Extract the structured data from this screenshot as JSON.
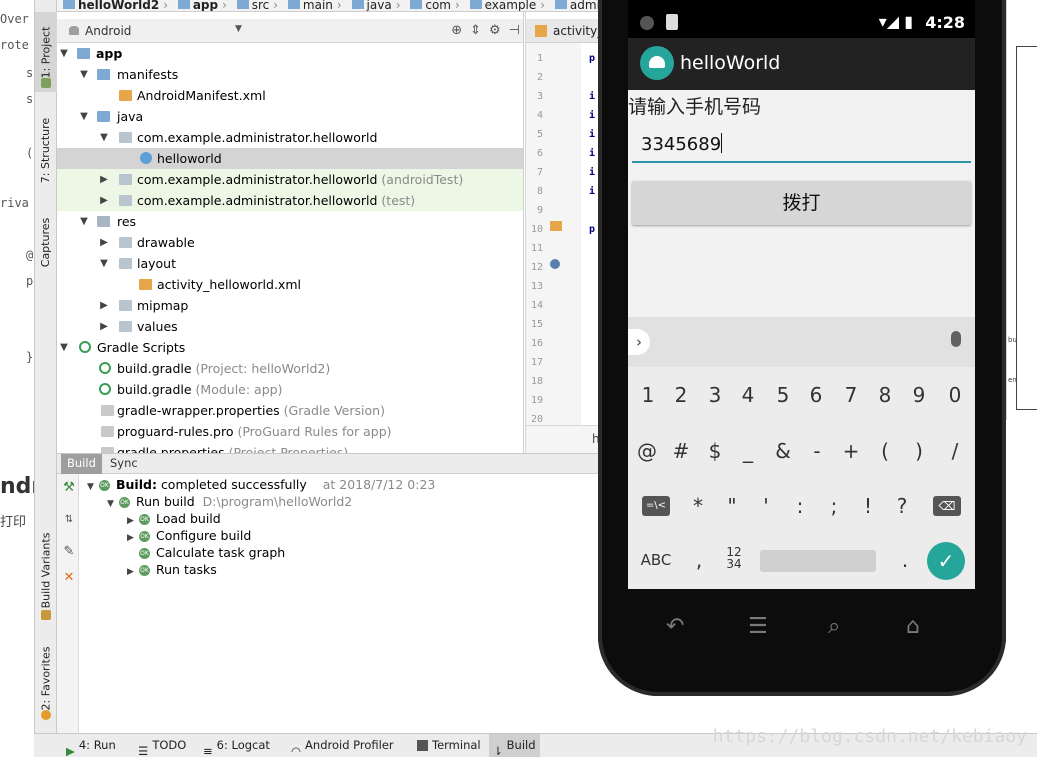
{
  "left_code": {
    "lines": [
      "Over",
      "rote",
      "s",
      "s",
      "(",
      "riva",
      "@",
      "p",
      "}"
    ],
    "big_text": "ndri",
    "cn_text": "打印"
  },
  "side_tabs": [
    "1: Project",
    "7: Structure",
    "Captures",
    "Build Variants",
    "2: Favorites"
  ],
  "navbar": {
    "crumbs": [
      "helloWorld2",
      "app",
      "src",
      "main",
      "java",
      "com",
      "example",
      "administrato"
    ]
  },
  "project": {
    "view_select": "Android",
    "tree": [
      {
        "label": "app",
        "hint": ""
      },
      {
        "label": "manifests",
        "hint": ""
      },
      {
        "label": "AndroidManifest.xml",
        "hint": ""
      },
      {
        "label": "java",
        "hint": ""
      },
      {
        "label": "com.example.administrator.helloworld",
        "hint": ""
      },
      {
        "label": "helloworld",
        "hint": ""
      },
      {
        "label": "com.example.administrator.helloworld",
        "hint": "(androidTest)"
      },
      {
        "label": "com.example.administrator.helloworld",
        "hint": "(test)"
      },
      {
        "label": "res",
        "hint": ""
      },
      {
        "label": "drawable",
        "hint": ""
      },
      {
        "label": "layout",
        "hint": ""
      },
      {
        "label": "activity_helloworld.xml",
        "hint": ""
      },
      {
        "label": "mipmap",
        "hint": ""
      },
      {
        "label": "values",
        "hint": ""
      },
      {
        "label": "Gradle Scripts",
        "hint": ""
      },
      {
        "label": "build.gradle",
        "hint": "(Project: helloWorld2)"
      },
      {
        "label": "build.gradle",
        "hint": "(Module: app)"
      },
      {
        "label": "gradle-wrapper.properties",
        "hint": "(Gradle Version)"
      },
      {
        "label": "proguard-rules.pro",
        "hint": "(ProGuard Rules for app)"
      },
      {
        "label": "gradle.properties",
        "hint": "(Project Properties)"
      }
    ]
  },
  "editor": {
    "tab_label": "activity_l",
    "line_numbers": [
      "1",
      "2",
      "3",
      "4",
      "5",
      "6",
      "7",
      "8",
      "9",
      "10",
      "11",
      "12",
      "13",
      "14",
      "15",
      "16",
      "17",
      "18",
      "19",
      "20"
    ],
    "code": [
      "p",
      "i",
      "i",
      "i",
      "i",
      "i",
      "i",
      "p"
    ],
    "status": "h"
  },
  "build": {
    "tabs": [
      "Build",
      "Sync"
    ],
    "summary_label": "Build:",
    "summary_text": "completed successfully",
    "summary_time": "at 2018/7/12 0:23",
    "run_build": "Run build",
    "run_path": "D:\\program\\helloWorld2",
    "steps": [
      "Load build",
      "Configure build",
      "Calculate task graph",
      "Run tasks"
    ]
  },
  "bottombar": {
    "items": [
      "4: Run",
      "TODO",
      "6: Logcat",
      "Android Profiler",
      "Terminal",
      "Build"
    ]
  },
  "phone": {
    "time": "4:28",
    "app_title": "helloWorld",
    "prompt": "请输入手机号码",
    "input_value": "3345689",
    "dial_button": "拨打",
    "keyboard": {
      "row1": [
        "1",
        "2",
        "3",
        "4",
        "5",
        "6",
        "7",
        "8",
        "9",
        "0"
      ],
      "row2": [
        "@",
        "#",
        "$",
        "_",
        "&",
        "-",
        "+",
        "(",
        ")",
        "/"
      ],
      "row3": [
        "=\\<",
        "*",
        "\"",
        "'",
        ":",
        ";",
        "!",
        "?",
        "⌫"
      ],
      "row4_abc": "ABC",
      "row4_comma": ",",
      "row4_nums": "12\n34",
      "row4_dot": "."
    }
  },
  "right_strip": {
    "labels": [
      "bu",
      "en"
    ]
  },
  "watermark": "https://blog.csdn.net/kebiaoy",
  "colors": {
    "accent": "#26a69a",
    "input_underline": "#2e95a8",
    "selected_row": "#d4d4d4",
    "test_row": "#edf7e6",
    "ok_green": "#5c9d5f"
  }
}
